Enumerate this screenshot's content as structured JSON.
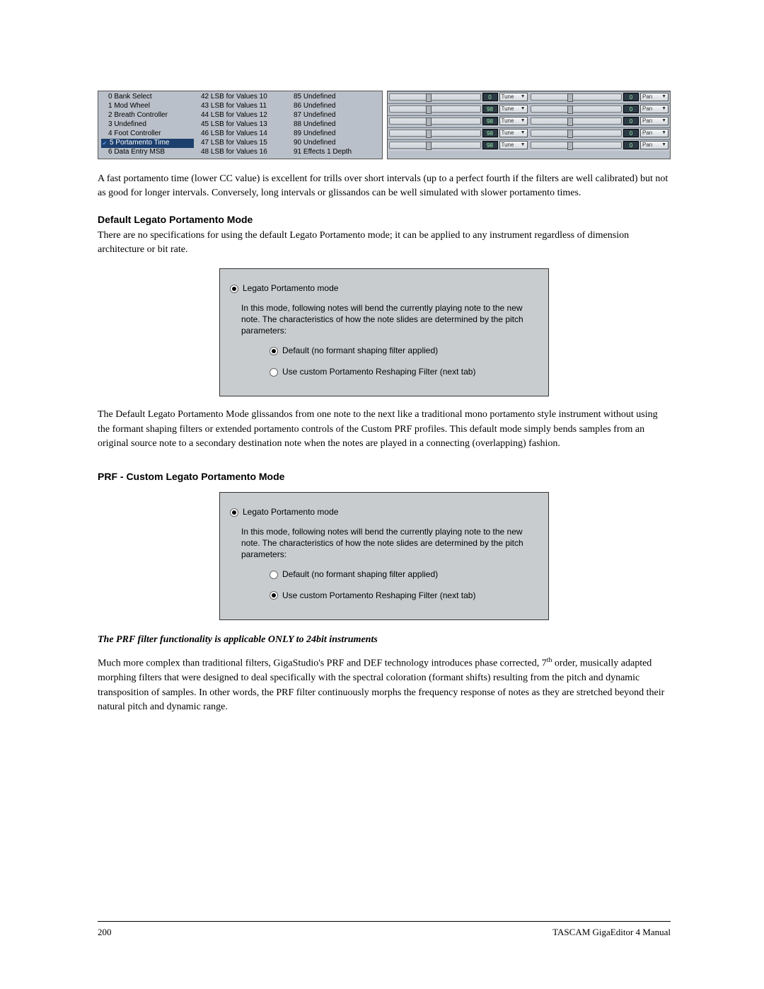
{
  "cc_list": {
    "col1": [
      "0 Bank Select",
      "1 Mod Wheel",
      "2 Breath Controller",
      "3 Undefined",
      "4 Foot Controller",
      "5 Portamento Time",
      "6 Data Entry MSB"
    ],
    "col2": [
      "42 LSB for Values 10",
      "43 LSB for Values 11",
      "44 LSB for Values 12",
      "45 LSB for Values 13",
      "46 LSB for Values 14",
      "47 LSB for Values 15",
      "48 LSB for Values 16"
    ],
    "col3": [
      "85 Undefined",
      "86 Undefined",
      "87 Undefined",
      "88 Undefined",
      "89 Undefined",
      "90 Undefined",
      "91 Effects 1 Depth"
    ],
    "selected_index": 5
  },
  "tune_rows": [
    {
      "v1": "0",
      "d1": "Tune",
      "v2": "0",
      "d2": "Pan"
    },
    {
      "v1": "98",
      "d1": "Tune",
      "v2": "0",
      "d2": "Pan"
    },
    {
      "v1": "98",
      "d1": "Tune",
      "v2": "0",
      "d2": "Pan"
    },
    {
      "v1": "98",
      "d1": "Tune",
      "v2": "0",
      "d2": "Pan"
    },
    {
      "v1": "98",
      "d1": "Tune",
      "v2": "0",
      "d2": "Pan"
    }
  ],
  "p1": "A fast portamento time (lower CC value) is excellent for trills over short intervals (up to a perfect fourth if the filters are well calibrated) but not as good for longer intervals. Conversely, long intervals or glissandos can be well simulated with slower portamento times.",
  "h1": "Default Legato Portamento Mode",
  "p2": "There are no specifications for using the default Legato Portamento mode; it can be applied to any instrument regardless of dimension architecture or bit rate.",
  "dialog": {
    "main_radio": "Legato Portamento mode",
    "desc": "In this mode, following notes will bend the currently playing note to the new note. The characteristics of how the note slides are determined by the pitch parameters:",
    "opt_default": "Default (no formant shaping filter applied)",
    "opt_custom": "Use custom Portamento Reshaping Filter (next tab)"
  },
  "p3": "The Default Legato Portamento Mode glissandos from one note to the next like a traditional mono portamento style instrument without using the formant shaping filters or extended portamento controls of the Custom PRF profiles. This default mode simply bends samples from an original source note to a secondary destination note when the notes are played in a connecting (overlapping) fashion.",
  "h2": "PRF - Custom Legato Portamento Mode",
  "emph": "The PRF filter functionality is applicable ONLY to 24bit instruments",
  "p4_a": "Much more complex than traditional filters, GigaStudio's PRF and DEF technology introduces phase corrected, 7",
  "p4_sup": "th",
  "p4_b": " order, musically adapted morphing filters that were designed to deal specifically with the spectral coloration (formant shifts) resulting from the pitch and dynamic transposition of samples. In other words, the PRF filter continuously morphs the frequency response of notes as they are stretched beyond their natural pitch and dynamic range.",
  "footer": {
    "page": "200",
    "title": "TASCAM GigaEditor 4 Manual"
  }
}
